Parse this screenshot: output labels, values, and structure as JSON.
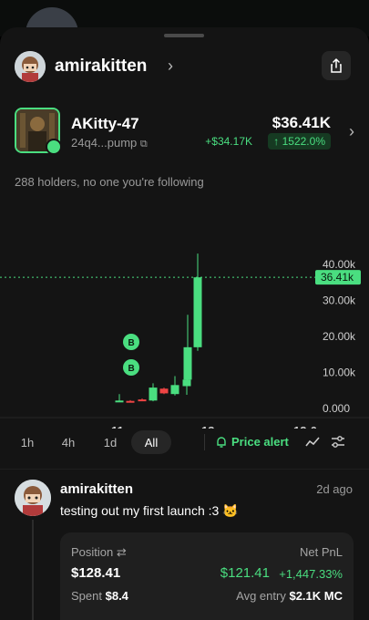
{
  "profile": {
    "username": "amirakitten"
  },
  "token": {
    "name": "AKitty-47",
    "address": "24q4...pump",
    "price": "$36.41K",
    "change_abs": "+$34.17K",
    "change_pct": "↑ 1522.0%"
  },
  "holders_text": "288 holders, no one you're following",
  "chart_data": {
    "type": "candlestick",
    "y_ticks": [
      "40.00k",
      "30.00k",
      "20.00k",
      "10.00k",
      "0.000"
    ],
    "x_ticks": [
      "11",
      "13",
      "12:0"
    ],
    "current_price_label": "36.41k",
    "current_price": 36410,
    "ylim": [
      0,
      40000
    ],
    "trade_markers": [
      "B",
      "B"
    ],
    "candles": [
      {
        "open": 2000,
        "high": 4000,
        "low": 1800,
        "close": 2200,
        "color": "green"
      },
      {
        "open": 2100,
        "high": 2300,
        "low": 1900,
        "close": 2000,
        "color": "red"
      },
      {
        "open": 2500,
        "high": 2800,
        "low": 2200,
        "close": 2400,
        "color": "red"
      },
      {
        "open": 2200,
        "high": 7000,
        "low": 2000,
        "close": 5800,
        "color": "green"
      },
      {
        "open": 5500,
        "high": 5800,
        "low": 4000,
        "close": 4200,
        "color": "red"
      },
      {
        "open": 4000,
        "high": 9000,
        "low": 3600,
        "close": 6500,
        "color": "green"
      },
      {
        "open": 6200,
        "high": 12000,
        "low": 3800,
        "close": 8000,
        "color": "green"
      },
      {
        "open": 8000,
        "high": 26000,
        "low": 7000,
        "close": 17000,
        "color": "green"
      },
      {
        "open": 17000,
        "high": 43000,
        "low": 16000,
        "close": 36410,
        "color": "green"
      }
    ]
  },
  "timeframes": [
    "1h",
    "4h",
    "1d",
    "All"
  ],
  "active_timeframe": "All",
  "price_alert_label": "Price alert",
  "post": {
    "author": "amirakitten",
    "time": "2d ago",
    "text": "testing out my first launch :3 🐱"
  },
  "position": {
    "position_label": "Position",
    "position_value": "$128.41",
    "pnl_label": "Net PnL",
    "pnl_value": "$121.41",
    "pnl_pct": "+1,447.33%",
    "spent_label": "Spent",
    "spent_value": "$8.4",
    "avg_label": "Avg entry",
    "avg_value": "$2.1K MC"
  },
  "colors": {
    "accent": "#4ade80",
    "down": "#ef4444",
    "background": "#141414"
  }
}
